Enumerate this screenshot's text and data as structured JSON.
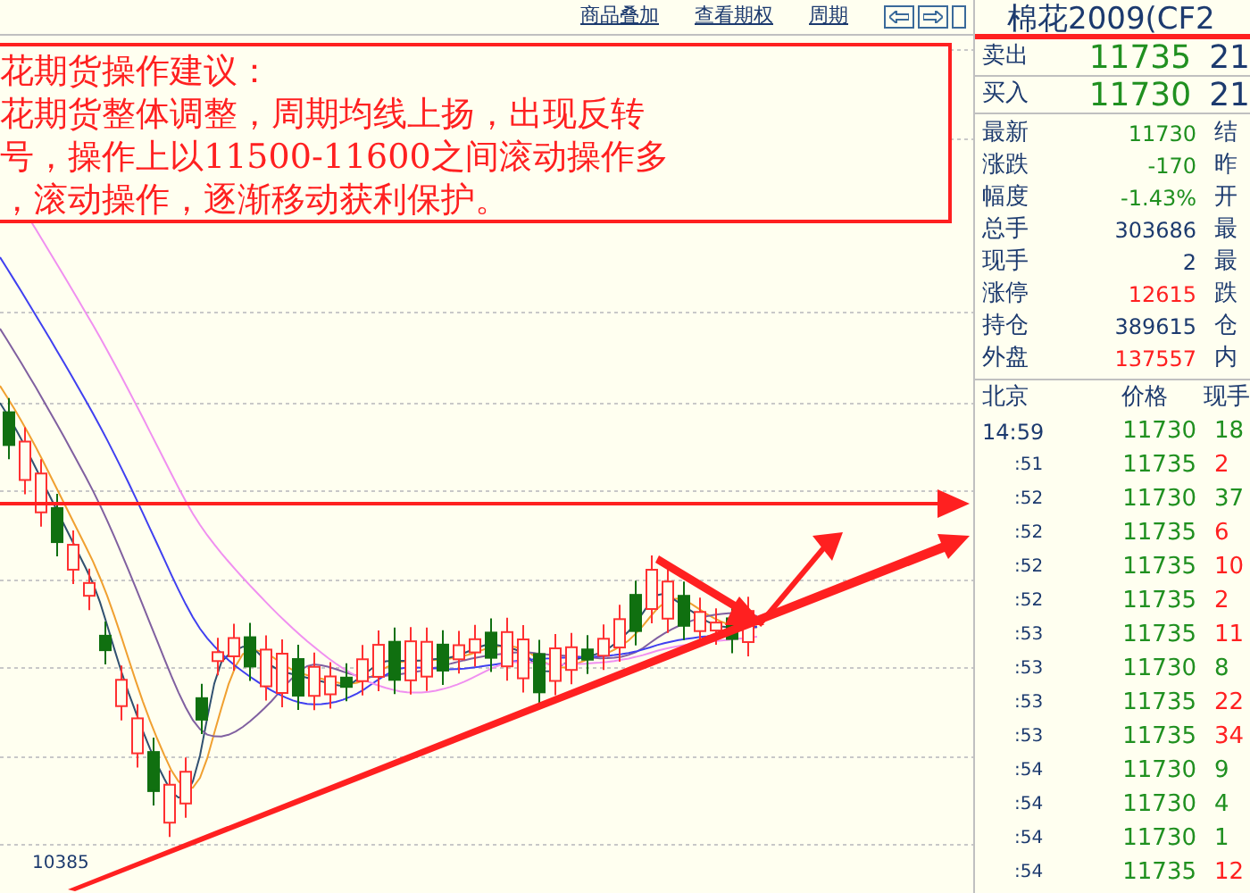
{
  "toolbar": {
    "links": [
      "商品叠加",
      "查看期权",
      "周期"
    ]
  },
  "annotation": {
    "lines": [
      "花期货操作建议：",
      "花期货整体调整，周期均线上扬，出现反转",
      "号，操作上以11500-11600之间滚动操作多",
      "，滚动操作，逐渐移动获利保护。"
    ]
  },
  "chart": {
    "low_label": "10385"
  },
  "quote": {
    "title": "棉花2009(CF2",
    "book": [
      {
        "label": "卖出",
        "price": "11735",
        "volume": "21"
      },
      {
        "label": "买入",
        "price": "11730",
        "volume": "21"
      }
    ],
    "stats": [
      {
        "label": "最新",
        "value": "11730",
        "color": "#209020",
        "label_2": "结"
      },
      {
        "label": "涨跌",
        "value": "-170",
        "color": "#209020",
        "label_2": "昨"
      },
      {
        "label": "幅度",
        "value": "-1.43%",
        "color": "#209020",
        "label_2": "开"
      },
      {
        "label": "总手",
        "value": "303686",
        "color": "#1c3a6e",
        "label_2": "最"
      },
      {
        "label": "现手",
        "value": "2",
        "color": "#1c3a6e",
        "label_2": "最"
      },
      {
        "label": "涨停",
        "value": "12615",
        "color": "#ff2020",
        "label_2": "跌"
      },
      {
        "label": "持仓",
        "value": "389615",
        "color": "#1c3a6e",
        "label_2": "仓"
      },
      {
        "label": "外盘",
        "value": "137557",
        "color": "#ff2020",
        "label_2": "内"
      }
    ],
    "ticks_header": [
      "北京",
      "价格",
      "现手"
    ],
    "ticks": [
      {
        "time": "14:59",
        "price": "11730",
        "volume": "18",
        "color": "#209020"
      },
      {
        "time": ":51",
        "price": "11735",
        "volume": "2",
        "color": "#ff2020"
      },
      {
        "time": ":52",
        "price": "11730",
        "volume": "37",
        "color": "#209020"
      },
      {
        "time": ":52",
        "price": "11735",
        "volume": "6",
        "color": "#ff2020"
      },
      {
        "time": ":52",
        "price": "11735",
        "volume": "10",
        "color": "#ff2020"
      },
      {
        "time": ":52",
        "price": "11735",
        "volume": "2",
        "color": "#ff2020"
      },
      {
        "time": ":53",
        "price": "11735",
        "volume": "11",
        "color": "#ff2020"
      },
      {
        "time": ":53",
        "price": "11730",
        "volume": "8",
        "color": "#209020"
      },
      {
        "time": ":53",
        "price": "11735",
        "volume": "22",
        "color": "#ff2020"
      },
      {
        "time": ":53",
        "price": "11735",
        "volume": "34",
        "color": "#ff2020"
      },
      {
        "time": ":54",
        "price": "11730",
        "volume": "9",
        "color": "#209020"
      },
      {
        "time": ":54",
        "price": "11730",
        "volume": "4",
        "color": "#209020"
      },
      {
        "time": ":54",
        "price": "11730",
        "volume": "1",
        "color": "#209020"
      },
      {
        "time": ":54",
        "price": "11735",
        "volume": "12",
        "color": "#ff2020"
      }
    ]
  }
}
